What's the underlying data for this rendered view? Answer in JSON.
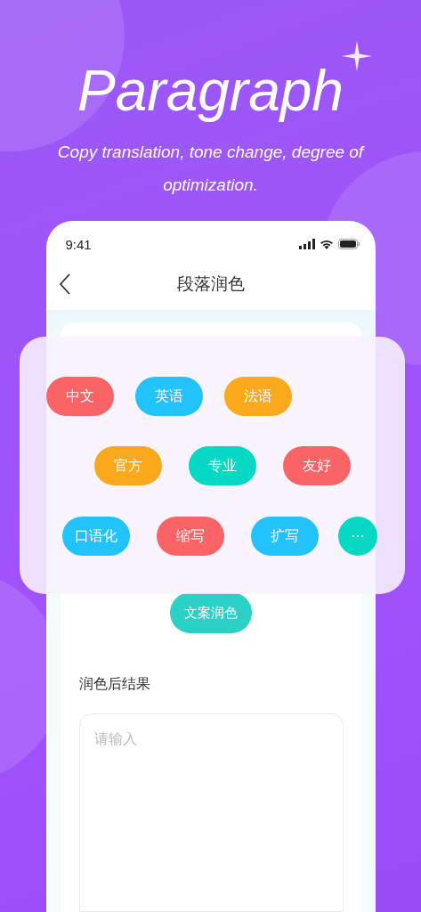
{
  "headline": "Paragraph",
  "subtitle": "Copy translation, tone change, degree of optimization.",
  "status_bar": {
    "time": "9:41"
  },
  "nav": {
    "title": "段落润色"
  },
  "action_button": "文案润色",
  "result_section": {
    "label": "润色后结果",
    "placeholder": "请输入"
  },
  "chip_rows": [
    [
      {
        "label": "中文",
        "color": "#fa6466"
      },
      {
        "label": "英语",
        "color": "#22c3fb"
      },
      {
        "label": "法语",
        "color": "#fba91c"
      }
    ],
    [
      {
        "label": "官方",
        "color": "#fba91c"
      },
      {
        "label": "专业",
        "color": "#05d9c3"
      },
      {
        "label": "友好",
        "color": "#fa6466"
      }
    ],
    [
      {
        "label": "口语化",
        "color": "#22c3fb"
      },
      {
        "label": "缩写",
        "color": "#fa6466"
      },
      {
        "label": "扩写",
        "color": "#22c3fb"
      },
      {
        "label": "···",
        "color": "#05d9c3",
        "kind": "round"
      }
    ]
  ]
}
